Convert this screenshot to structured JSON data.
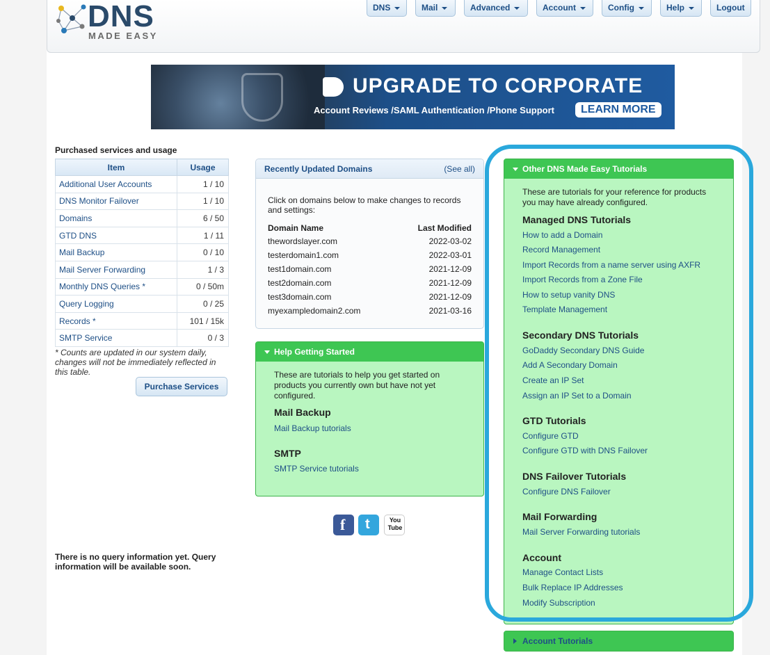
{
  "brand": {
    "logo_main": "DNS",
    "logo_sub": "MADE EASY"
  },
  "nav": [
    {
      "label": "DNS",
      "dropdown": true
    },
    {
      "label": "Mail",
      "dropdown": true
    },
    {
      "label": "Advanced",
      "dropdown": true
    },
    {
      "label": "Account",
      "dropdown": true
    },
    {
      "label": "Config",
      "dropdown": true
    },
    {
      "label": "Help",
      "dropdown": true
    },
    {
      "label": "Logout",
      "dropdown": false
    }
  ],
  "banner": {
    "headline": "UPGRADE TO CORPORATE",
    "subline": "Account Reviews /SAML Authentication /Phone Support",
    "cta": "LEARN MORE"
  },
  "usage": {
    "title": "Purchased services and usage",
    "col_item": "Item",
    "col_usage": "Usage",
    "rows": [
      {
        "item": "Additional User Accounts",
        "usage": "1 / 10"
      },
      {
        "item": "DNS Monitor Failover",
        "usage": "1 / 10"
      },
      {
        "item": "Domains",
        "usage": "6 / 50"
      },
      {
        "item": "GTD DNS",
        "usage": "1 / 11"
      },
      {
        "item": "Mail Backup",
        "usage": "0 / 10"
      },
      {
        "item": "Mail Server Forwarding",
        "usage": "1 / 3"
      },
      {
        "item": "Monthly DNS Queries *",
        "usage": "0 / 50m"
      },
      {
        "item": "Query Logging",
        "usage": "0 / 25"
      },
      {
        "item": "Records *",
        "usage": "101 / 15k"
      },
      {
        "item": "SMTP Service",
        "usage": "0 / 3"
      }
    ],
    "note": "* Counts are updated in our system daily, changes will not be immediately reflected in this table.",
    "purchase_button": "Purchase Services"
  },
  "query_message": "There is no query information yet. Query information will be available soon.",
  "recent": {
    "title": "Recently Updated Domains",
    "see_all": "(See all)",
    "intro": "Click on domains below to make changes to records and settings:",
    "col_domain": "Domain Name",
    "col_modified": "Last Modified",
    "rows": [
      {
        "domain": "thewordslayer.com",
        "modified": "2022-03-02"
      },
      {
        "domain": "testerdomain1.com",
        "modified": "2022-03-01"
      },
      {
        "domain": "test1domain.com",
        "modified": "2021-12-09"
      },
      {
        "domain": "test2domain.com",
        "modified": "2021-12-09"
      },
      {
        "domain": "test3domain.com",
        "modified": "2021-12-09"
      },
      {
        "domain": "myexampledomain2.com",
        "modified": "2021-03-16"
      }
    ]
  },
  "help": {
    "title": "Help Getting Started",
    "intro": "These are tutorials to help you get started on products you currently own but have not yet configured.",
    "sections": [
      {
        "heading": "Mail Backup",
        "link": "Mail Backup tutorials"
      },
      {
        "heading": "SMTP",
        "link": "SMTP Service tutorials"
      }
    ]
  },
  "other": {
    "title": "Other DNS Made Easy Tutorials",
    "intro": "These are tutorials for your reference for products you may have already configured.",
    "sections": [
      {
        "heading": "Managed DNS Tutorials",
        "links": [
          "How to add a Domain",
          "Record Management",
          "Import Records from a name server using AXFR",
          "Import Records from a Zone File",
          "How to setup vanity DNS",
          "Template Management"
        ]
      },
      {
        "heading": "Secondary DNS Tutorials",
        "links": [
          "GoDaddy Secondary DNS Guide",
          "Add A Secondary Domain",
          "Create an IP Set",
          "Assign an IP Set to a Domain"
        ]
      },
      {
        "heading": "GTD Tutorials",
        "links": [
          "Configure GTD",
          "Configure GTD with DNS Failover"
        ]
      },
      {
        "heading": "DNS Failover Tutorials",
        "links": [
          "Configure DNS Failover"
        ]
      },
      {
        "heading": "Mail Forwarding",
        "links": [
          "Mail Server Forwarding tutorials"
        ]
      },
      {
        "heading": "Account",
        "links": [
          "Manage Contact Lists",
          "Bulk Replace IP Addresses",
          "Modify Subscription"
        ]
      }
    ]
  },
  "account_tutorials": {
    "title": "Account Tutorials"
  },
  "social": [
    {
      "icon": "facebook-icon",
      "glyph": "f",
      "color": "#3b5998"
    },
    {
      "icon": "twitter-icon",
      "glyph": "t",
      "color": "#33a6dd"
    },
    {
      "icon": "youtube-icon",
      "glyph": "You Tube",
      "color": "#c4302b"
    }
  ],
  "colors": {
    "accent": "#1e4f86",
    "green_header": "#3ec653",
    "green_panel": "#b9f6c0",
    "highlight": "#2aa8dc"
  }
}
